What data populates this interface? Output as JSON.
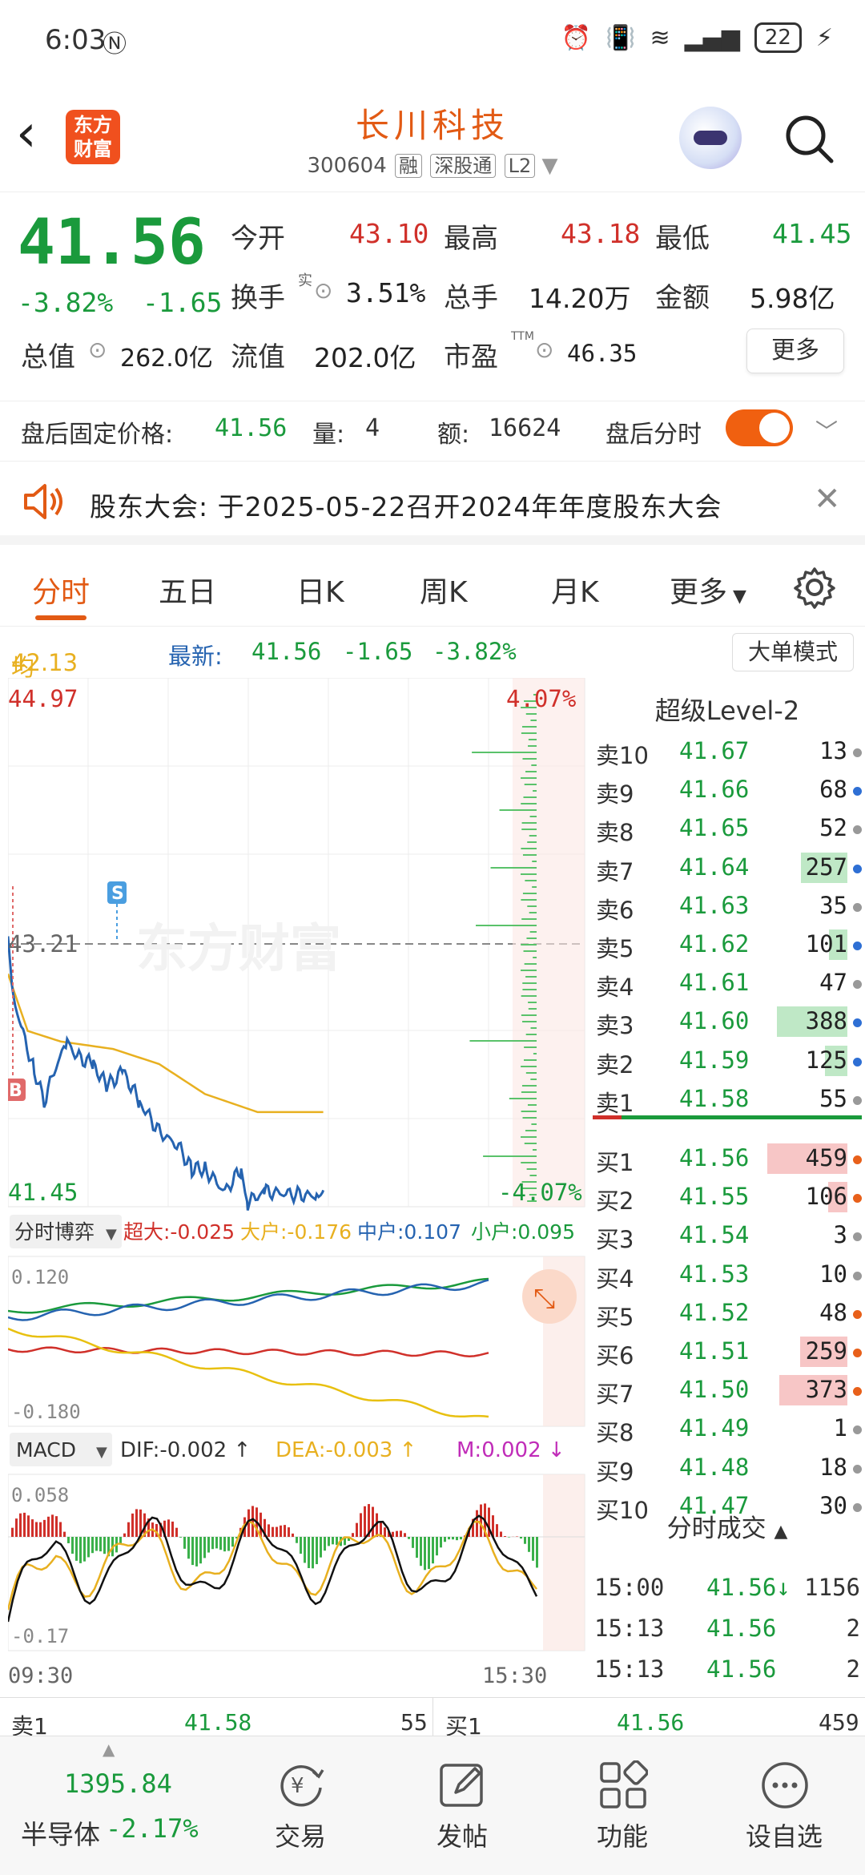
{
  "status_bar": {
    "time": "6:03",
    "battery": "22"
  },
  "header": {
    "logo_line1": "东方",
    "logo_line2": "财富",
    "stock_name": "长川科技",
    "stock_code": "300604",
    "tags": [
      "融",
      "深股通",
      "L2"
    ]
  },
  "quote": {
    "price": "41.56",
    "change_pct": "-3.82%",
    "change": "-1.65",
    "open_label": "今开",
    "open": "43.10",
    "high_label": "最高",
    "high": "43.18",
    "low_label": "最低",
    "low": "41.45",
    "turnover_label": "换手",
    "turnover_sup": "实",
    "turnover": "3.51%",
    "volume_label": "总手",
    "volume": "14.20万",
    "amount_label": "金额",
    "amount": "5.98亿",
    "mcap_label": "总值",
    "mcap": "262.0亿",
    "float_label": "流值",
    "float": "202.0亿",
    "pe_label": "市盈",
    "pe_sup": "TTM",
    "pe": "46.35",
    "more_button": "更多"
  },
  "after_hours": {
    "price_label": "盘后固定价格:",
    "price": "41.56",
    "vol_label": "量:",
    "vol": "4",
    "amt_label": "额:",
    "amt": "16624",
    "toggle_label": "盘后分时"
  },
  "notice": {
    "text": "股东大会: 于2025-05-22召开2024年年度股东大会"
  },
  "tabs": [
    "分时",
    "五日",
    "日K",
    "周K",
    "月K",
    "更多"
  ],
  "avg_line": {
    "avg_label": "均价:",
    "avg": "42.13",
    "latest_label": "最新:",
    "latest": "41.56",
    "change": "-1.65",
    "change_pct": "-3.82%",
    "big_order_button": "大单模式"
  },
  "chart": {
    "y_top": "44.97",
    "y_top_pct": "4.07%",
    "y_bottom": "41.45",
    "y_bottom_pct": "-4.07%",
    "prev_close": "43.21",
    "watermark": "东方财富",
    "sell_marker": "S",
    "buy_marker": "B",
    "indicator1_select": "分时博弈",
    "ind1_super": "超大:-0.025",
    "ind1_large": "大户:-0.176",
    "ind1_medium": "中户:0.107",
    "ind1_small": "小户:0.095",
    "ind1_top": "0.120",
    "ind1_bottom": "-0.180",
    "indicator2_select": "MACD",
    "macd_dif": "DIF:-0.002 ↑",
    "macd_dea": "DEA:-0.003 ↑",
    "macd_m": "M:0.002 ↓",
    "macd_top": "0.058",
    "macd_bottom": "-0.17",
    "time_start": "09:30",
    "time_end": "15:30",
    "colors": {
      "price": "#2563b0",
      "avg": "#e8b020",
      "up": "#d0302a",
      "down": "#1a9a3c"
    }
  },
  "level2": {
    "title": "超级Level-2",
    "asks": [
      {
        "label": "卖10",
        "price": "41.67",
        "vol": "13",
        "dot": "#999"
      },
      {
        "label": "卖9",
        "price": "41.66",
        "vol": "68",
        "dot": "#2e6fd4"
      },
      {
        "label": "卖8",
        "price": "41.65",
        "vol": "52",
        "dot": "#999"
      },
      {
        "label": "卖7",
        "price": "41.64",
        "vol": "257",
        "dot": "#2e6fd4"
      },
      {
        "label": "卖6",
        "price": "41.63",
        "vol": "35",
        "dot": "#999"
      },
      {
        "label": "卖5",
        "price": "41.62",
        "vol": "101",
        "dot": "#2e6fd4"
      },
      {
        "label": "卖4",
        "price": "41.61",
        "vol": "47",
        "dot": "#999"
      },
      {
        "label": "卖3",
        "price": "41.60",
        "vol": "388",
        "dot": "#2e6fd4"
      },
      {
        "label": "卖2",
        "price": "41.59",
        "vol": "125",
        "dot": "#2e6fd4"
      },
      {
        "label": "卖1",
        "price": "41.58",
        "vol": "55",
        "dot": "#999"
      }
    ],
    "bids": [
      {
        "label": "买1",
        "price": "41.56",
        "vol": "459",
        "dot": "#e8601a"
      },
      {
        "label": "买2",
        "price": "41.55",
        "vol": "106",
        "dot": "#e8601a"
      },
      {
        "label": "买3",
        "price": "41.54",
        "vol": "3",
        "dot": "#999"
      },
      {
        "label": "买4",
        "price": "41.53",
        "vol": "10",
        "dot": "#999"
      },
      {
        "label": "买5",
        "price": "41.52",
        "vol": "48",
        "dot": "#e8601a"
      },
      {
        "label": "买6",
        "price": "41.51",
        "vol": "259",
        "dot": "#e8601a"
      },
      {
        "label": "买7",
        "price": "41.50",
        "vol": "373",
        "dot": "#e8601a"
      },
      {
        "label": "买8",
        "price": "41.49",
        "vol": "1",
        "dot": "#999"
      },
      {
        "label": "买9",
        "price": "41.48",
        "vol": "18",
        "dot": "#999"
      },
      {
        "label": "买10",
        "price": "41.47",
        "vol": "30",
        "dot": "#999"
      }
    ],
    "trades_title": "分时成交",
    "trades": [
      {
        "time": "15:00",
        "price": "41.56↓",
        "vol": "1156"
      },
      {
        "time": "15:13",
        "price": "41.56",
        "vol": "2"
      },
      {
        "time": "15:13",
        "price": "41.56",
        "vol": "2"
      }
    ]
  },
  "summary_row": {
    "ask_label": "卖1",
    "ask_price": "41.58",
    "ask_vol": "55",
    "bid_label": "买1",
    "bid_price": "41.56",
    "bid_vol": "459"
  },
  "bottom_nav": {
    "index_value": "1395.84",
    "index_name": "半导体",
    "index_change": "-2.17%",
    "items": [
      "交易",
      "发帖",
      "功能",
      "设自选"
    ]
  }
}
